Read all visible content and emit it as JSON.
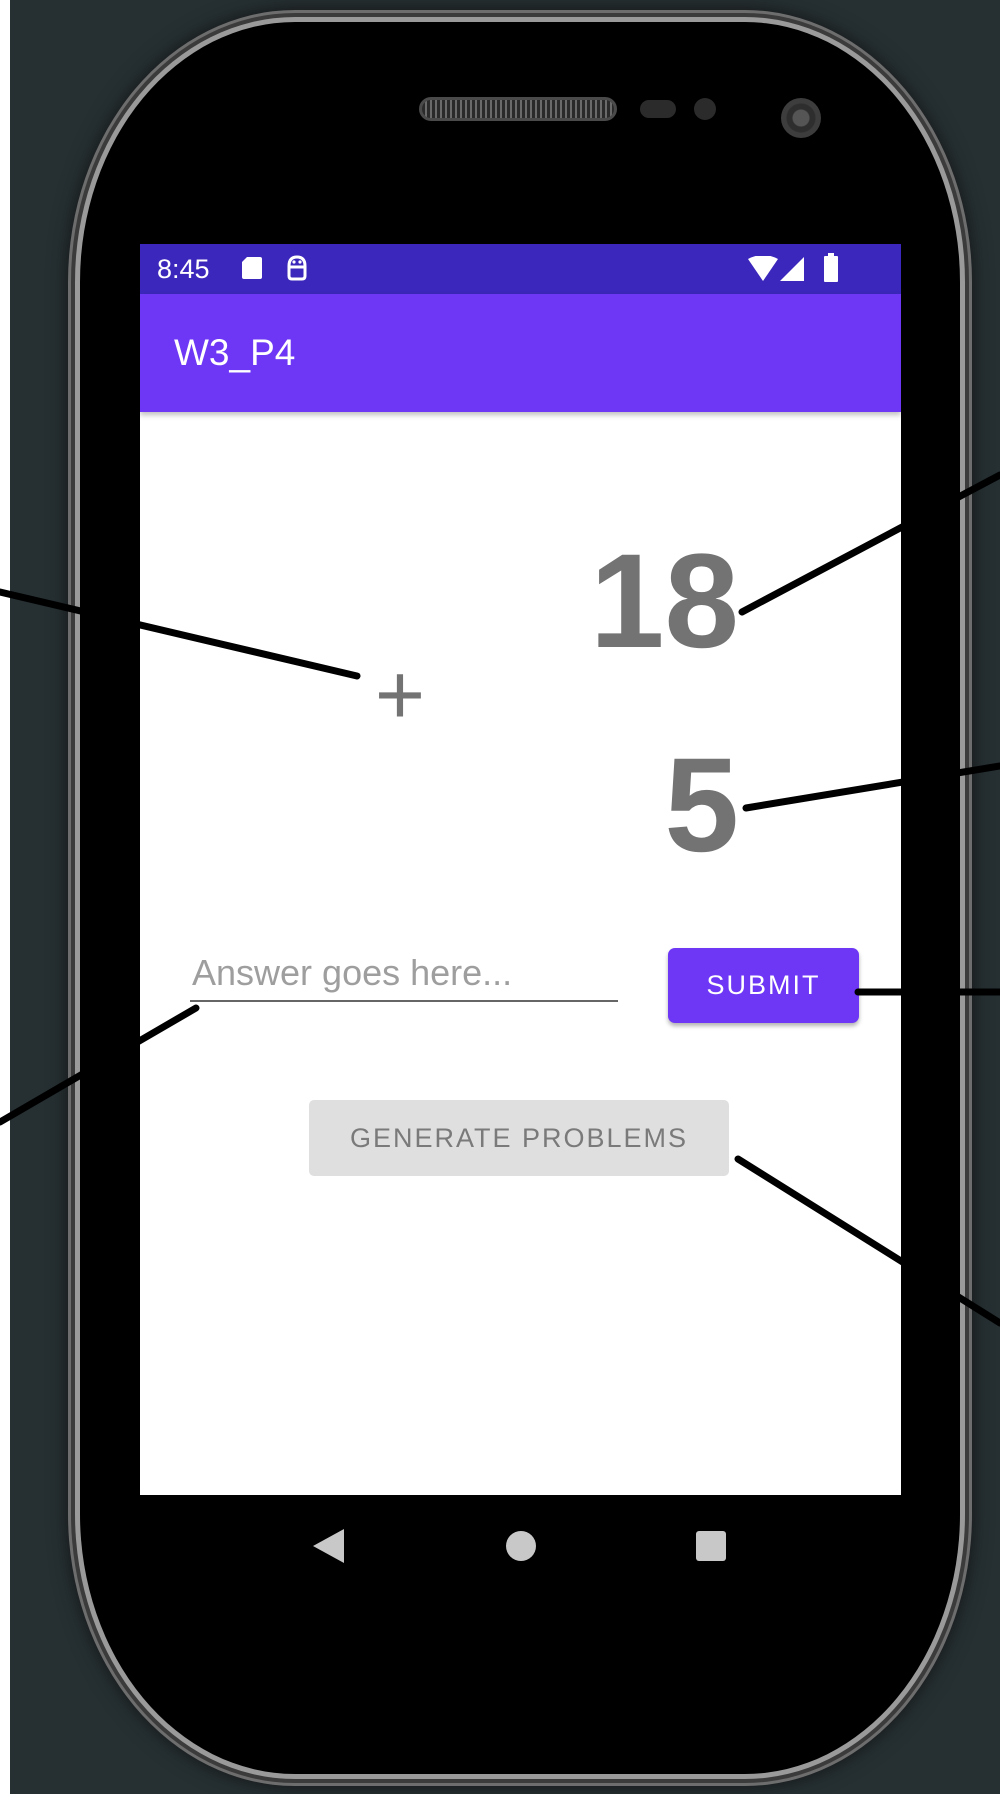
{
  "statusbar": {
    "time": "8:45",
    "icons": [
      "sd-card-icon",
      "android-debug-icon",
      "wifi-icon",
      "cell-signal-icon",
      "battery-icon"
    ]
  },
  "appbar": {
    "title": "W3_P4"
  },
  "problem": {
    "first_number": "18",
    "operator": "+",
    "second_number": "5"
  },
  "answer": {
    "value": "",
    "placeholder": "Answer goes here..."
  },
  "buttons": {
    "submit_label": "SUBMIT",
    "generate_label": "GENERATE PROBLEMS"
  },
  "navbar": {
    "icons": [
      "back-icon",
      "home-icon",
      "recents-icon"
    ]
  },
  "colors": {
    "statusbar": "#3b27bb",
    "appbar": "#6d37f5",
    "primary_button": "#6d37f5",
    "disabled_button": "#dfdfdf",
    "number_text": "#737373",
    "background": "#263033"
  }
}
